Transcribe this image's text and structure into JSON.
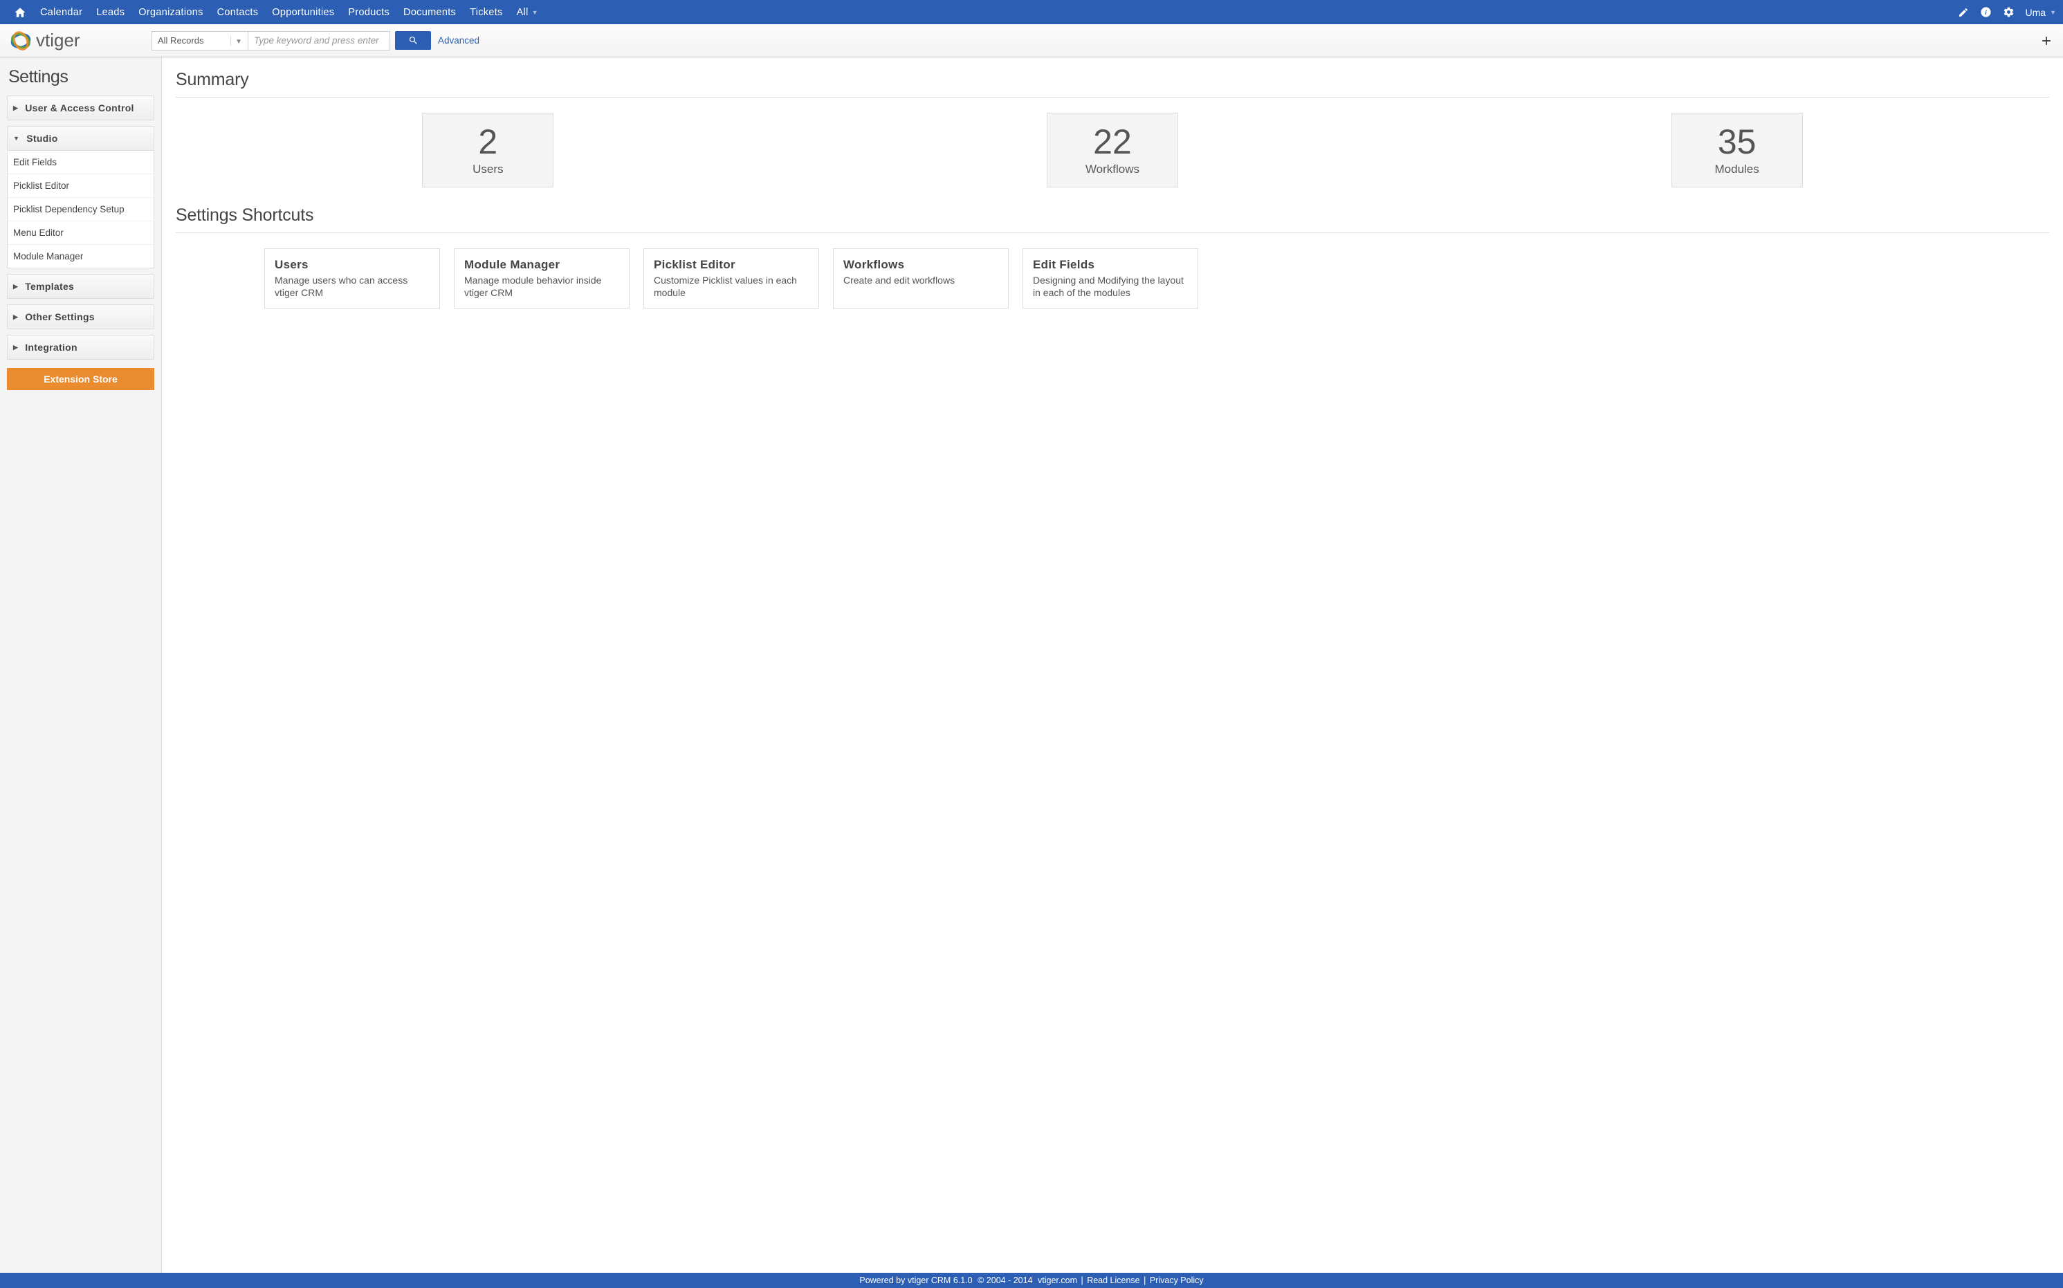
{
  "topnav": {
    "items": [
      "Calendar",
      "Leads",
      "Organizations",
      "Contacts",
      "Opportunities",
      "Products",
      "Documents",
      "Tickets",
      "All"
    ],
    "user": "Uma"
  },
  "search": {
    "selector": "All Records",
    "placeholder": "Type keyword and press enter",
    "advanced": "Advanced"
  },
  "sidebar": {
    "title": "Settings",
    "sections": {
      "user_access": "User & Access Control",
      "studio": "Studio",
      "templates": "Templates",
      "other": "Other Settings",
      "integration": "Integration"
    },
    "studio_items": [
      "Edit Fields",
      "Picklist Editor",
      "Picklist Dependency Setup",
      "Menu Editor",
      "Module Manager"
    ],
    "extension_button": "Extension Store"
  },
  "summary": {
    "title": "Summary",
    "stats": [
      {
        "value": "2",
        "label": "Users"
      },
      {
        "value": "22",
        "label": "Workflows"
      },
      {
        "value": "35",
        "label": "Modules"
      }
    ]
  },
  "shortcuts_section": {
    "title": "Settings Shortcuts",
    "cards": [
      {
        "title": "Users",
        "desc": "Manage users who can access vtiger CRM"
      },
      {
        "title": "Module Manager",
        "desc": "Manage module behavior inside vtiger CRM"
      },
      {
        "title": "Picklist Editor",
        "desc": "Customize Picklist values in each module"
      },
      {
        "title": "Workflows",
        "desc": "Create and edit workflows"
      },
      {
        "title": "Edit Fields",
        "desc": "Designing and Modifying the layout in each of the modules"
      }
    ]
  },
  "footer": {
    "powered": "Powered by vtiger CRM 6.1.0",
    "copy": "© 2004 - 2014",
    "site": "vtiger.com",
    "license": "Read License",
    "privacy": "Privacy Policy"
  }
}
